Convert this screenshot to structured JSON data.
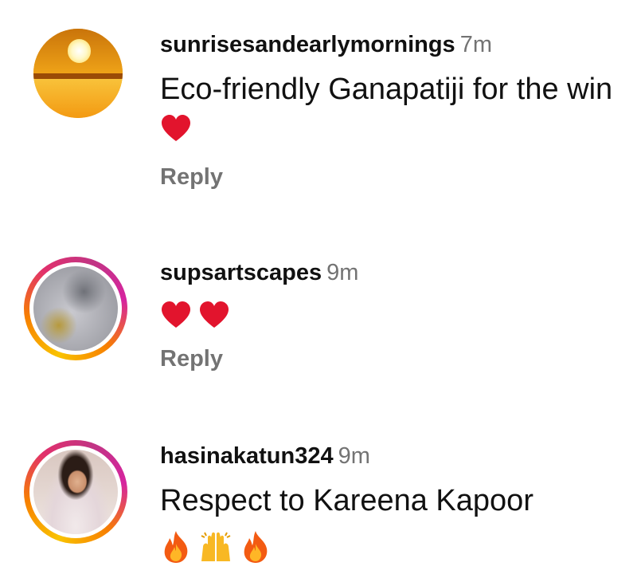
{
  "comments": [
    {
      "username": "sunrisesandearlymornings",
      "time": "7m",
      "text": "Eco-friendly Ganapatiji for the win",
      "emojis": [
        "heart"
      ],
      "reply_label": "Reply",
      "avatar": "sunrise-avatar"
    },
    {
      "username": "supsartscapes",
      "time": "9m",
      "text": "",
      "emojis": [
        "heart",
        "heart"
      ],
      "reply_label": "Reply",
      "avatar": "moon-avatar"
    },
    {
      "username": "hasinakatun324",
      "time": "9m",
      "text": "Respect to Kareena Kapoor",
      "emojis": [
        "fire",
        "raising-hands",
        "fire"
      ],
      "reply_label": "",
      "avatar": "person-avatar"
    }
  ],
  "colors": {
    "text": "#111111",
    "muted": "#737373",
    "heart": "#e2142d",
    "story_ring_start": "#f9c300",
    "story_ring_end": "#d6249f"
  }
}
